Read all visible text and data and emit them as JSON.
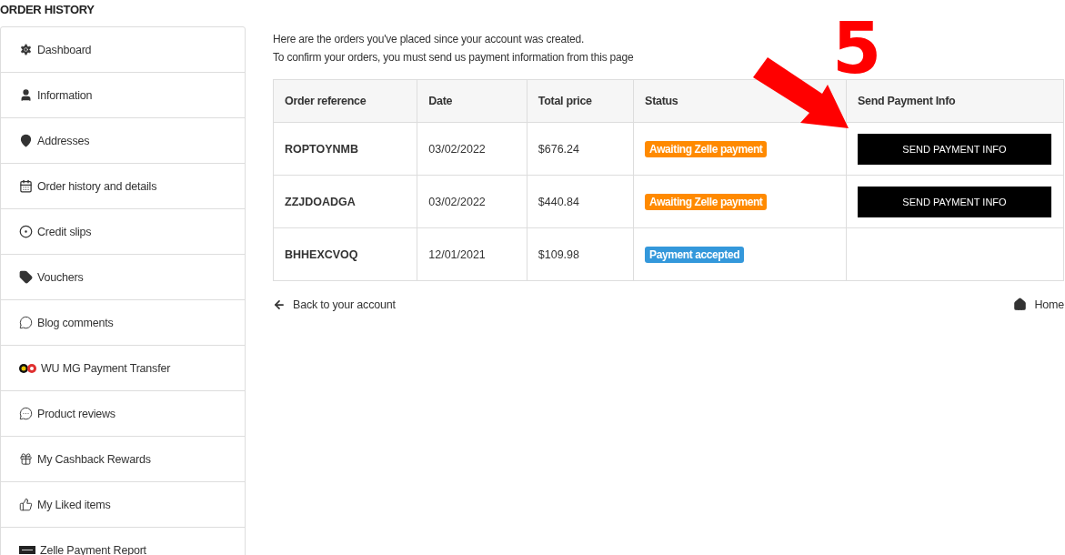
{
  "page_title": "ORDER HISTORY",
  "sidebar": {
    "items": [
      {
        "label": "Dashboard"
      },
      {
        "label": "Information"
      },
      {
        "label": "Addresses"
      },
      {
        "label": "Order history and details"
      },
      {
        "label": "Credit slips"
      },
      {
        "label": "Vouchers"
      },
      {
        "label": "Blog comments"
      },
      {
        "label": "WU MG Payment Transfer"
      },
      {
        "label": "Product reviews"
      },
      {
        "label": "My Cashback Rewards"
      },
      {
        "label": "My Liked items"
      },
      {
        "label": "Zelle Payment Report"
      }
    ]
  },
  "intro": [
    "Here are the orders you've placed since your account was created.",
    "To confirm your orders, you must send us payment information from this page"
  ],
  "table": {
    "columns": [
      "Order reference",
      "Date",
      "Total price",
      "Status",
      "Send Payment Info"
    ],
    "rows": [
      {
        "reference": "ROPTOYNMB",
        "date": "03/02/2022",
        "total": "$676.24",
        "status": {
          "label": "Awaiting Zelle payment",
          "color": "#ff8a00"
        },
        "action": "SEND PAYMENT INFO"
      },
      {
        "reference": "ZZJDOADGA",
        "date": "03/02/2022",
        "total": "$440.84",
        "status": {
          "label": "Awaiting Zelle payment",
          "color": "#ff8a00"
        },
        "action": "SEND PAYMENT INFO"
      },
      {
        "reference": "BHHEXCVOQ",
        "date": "12/01/2021",
        "total": "$109.98",
        "status": {
          "label": "Payment accepted",
          "color": "#3498db"
        }
      }
    ]
  },
  "footer_links": {
    "back": "Back to your account",
    "home": "Home"
  },
  "annotation": {
    "label": "5"
  }
}
